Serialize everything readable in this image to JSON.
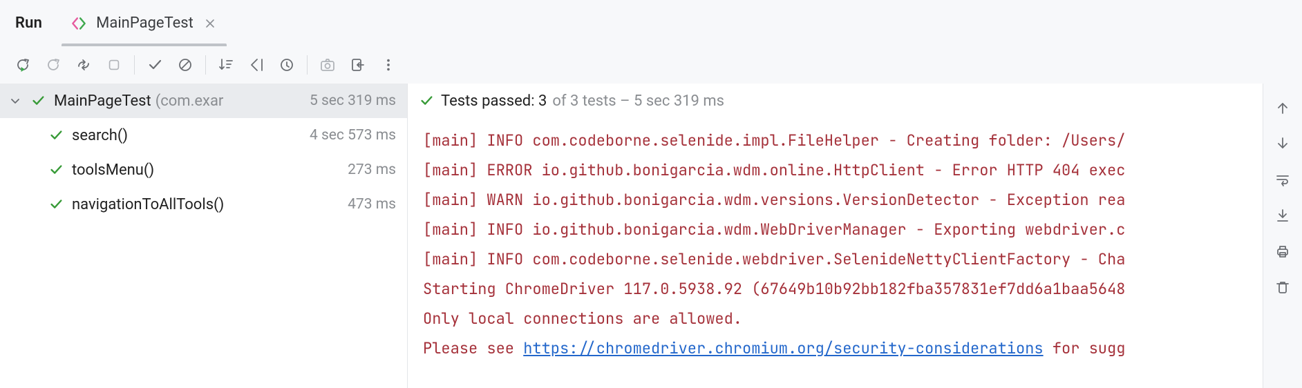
{
  "header": {
    "title": "Run",
    "tab": {
      "label": "MainPageTest"
    }
  },
  "tree": {
    "root": {
      "name": "MainPageTest",
      "package_truncated": "(com.exar",
      "duration": "5 sec 319 ms"
    },
    "tests": [
      {
        "name": "search()",
        "duration": "4 sec 573 ms"
      },
      {
        "name": "toolsMenu()",
        "duration": "273 ms"
      },
      {
        "name": "navigationToAllTools()",
        "duration": "473 ms"
      }
    ]
  },
  "console_header": {
    "passed_label": "Tests passed:",
    "passed_count": "3",
    "of_label": "of 3 tests",
    "dash": "–",
    "duration": "5 sec 319 ms"
  },
  "console_lines": {
    "l0": "[main] INFO com.codeborne.selenide.impl.FileHelper - Creating folder: /Users/",
    "l1": "[main] ERROR io.github.bonigarcia.wdm.online.HttpClient - Error HTTP 404 exec",
    "l2": "[main] WARN io.github.bonigarcia.wdm.versions.VersionDetector - Exception rea",
    "l3": "[main] INFO io.github.bonigarcia.wdm.WebDriverManager - Exporting webdriver.c",
    "l4": "[main] INFO com.codeborne.selenide.webdriver.SelenideNettyClientFactory - Cha",
    "l5": "Starting ChromeDriver 117.0.5938.92 (67649b10b92bb182fba357831ef7dd6a1baa5648",
    "l6": "Only local connections are allowed.",
    "l7_prefix": "Please see ",
    "l7_link": "https://chromedriver.chromium.org/security-considerations",
    "l7_suffix": " for sugg"
  }
}
